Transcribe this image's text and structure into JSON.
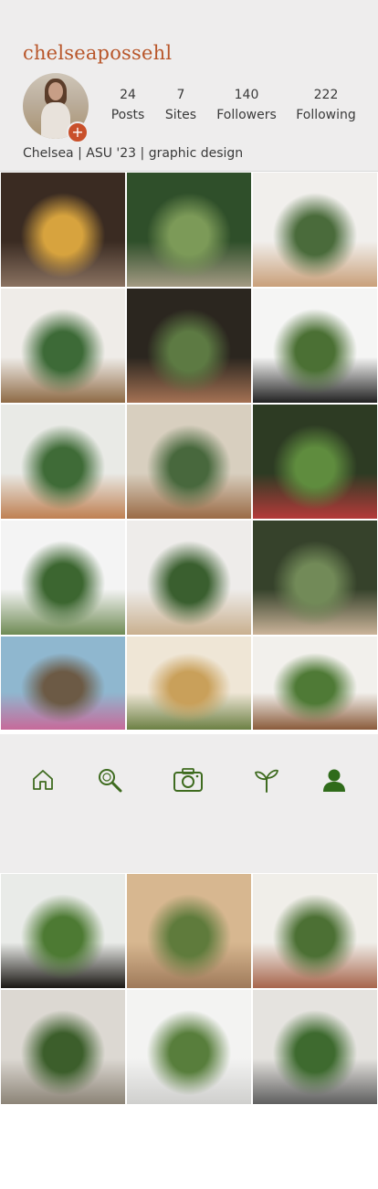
{
  "profile": {
    "username": "chelseapossehl",
    "bio": "Chelsea | ASU '23 | graphic design",
    "stats": [
      {
        "value": "24",
        "label": "Posts"
      },
      {
        "value": "7",
        "label": "Sites"
      },
      {
        "value": "140",
        "label": "Followers"
      },
      {
        "value": "222",
        "label": "Following"
      }
    ]
  },
  "grid_top": [
    {
      "name": "photo-mustard-chair-room",
      "colors": [
        "#3a2b22",
        "#d7a33e",
        "#8a7261"
      ]
    },
    {
      "name": "photo-greenhouse-path",
      "colors": [
        "#2f4f2a",
        "#7c9a58",
        "#a39a83"
      ]
    },
    {
      "name": "photo-monstera-white-room",
      "colors": [
        "#f1efec",
        "#4a6b3b",
        "#c9a07a"
      ]
    },
    {
      "name": "photo-monstera-bed",
      "colors": [
        "#efece8",
        "#3d6a37",
        "#8e6a45"
      ]
    },
    {
      "name": "photo-arch-garden",
      "colors": [
        "#2b261f",
        "#5d7a43",
        "#a57254"
      ]
    },
    {
      "name": "photo-snake-plant",
      "colors": [
        "#f5f5f4",
        "#4b7034",
        "#222222"
      ]
    },
    {
      "name": "photo-plant-shelves",
      "colors": [
        "#e9eae6",
        "#3f6b37",
        "#bf8052"
      ]
    },
    {
      "name": "photo-boho-plant-wall",
      "colors": [
        "#d8cfbf",
        "#48683d",
        "#9a6b46"
      ]
    },
    {
      "name": "photo-pothos-books",
      "colors": [
        "#2d3b23",
        "#5f8c3e",
        "#b53a3a"
      ]
    },
    {
      "name": "photo-vertical-forest",
      "colors": [
        "#f4f4f4",
        "#3c6630",
        "#6f8b55"
      ]
    },
    {
      "name": "photo-hanging-pothos-pot",
      "colors": [
        "#eeecea",
        "#3a5f2f",
        "#c9b08f"
      ]
    },
    {
      "name": "photo-garden-patio",
      "colors": [
        "#36422b",
        "#728a58",
        "#cbb49a"
      ]
    },
    {
      "name": "photo-coast-house",
      "colors": [
        "#8fb7cf",
        "#6c5a45",
        "#c76a9a"
      ]
    },
    {
      "name": "photo-bamboo-bathroom",
      "colors": [
        "#efe6d6",
        "#c9a05a",
        "#6c8044"
      ]
    },
    {
      "name": "photo-ivy-door",
      "colors": [
        "#f2f0ec",
        "#4f7a36",
        "#8a5b3b"
      ]
    }
  ],
  "nav": {
    "home_icon": "home-icon",
    "search_icon": "search-icon",
    "camera_icon": "camera-icon",
    "sprout_icon": "sprout-icon",
    "profile_icon": "profile-icon",
    "accent": "#3e6b1f"
  },
  "grid_bottom": [
    {
      "name": "photo-cat-with-plants",
      "colors": [
        "#e9ebe8",
        "#4d7a33",
        "#1b1814"
      ]
    },
    {
      "name": "photo-sunroom-sofa",
      "colors": [
        "#d7b790",
        "#5f7b3c",
        "#9f7a5a"
      ]
    },
    {
      "name": "photo-plant-rack",
      "colors": [
        "#f0eee9",
        "#4c7034",
        "#a7654c"
      ]
    },
    {
      "name": "photo-fiddle-leaf-shadow",
      "colors": [
        "#dcd8d2",
        "#3c5e2b",
        "#8c8477"
      ]
    },
    {
      "name": "photo-white-bathroom",
      "colors": [
        "#f3f3f2",
        "#587e3c",
        "#cfcfcd"
      ]
    },
    {
      "name": "photo-hanging-bulbs-plants",
      "colors": [
        "#e5e3df",
        "#3e6a2f",
        "#5f5f5f"
      ]
    }
  ]
}
